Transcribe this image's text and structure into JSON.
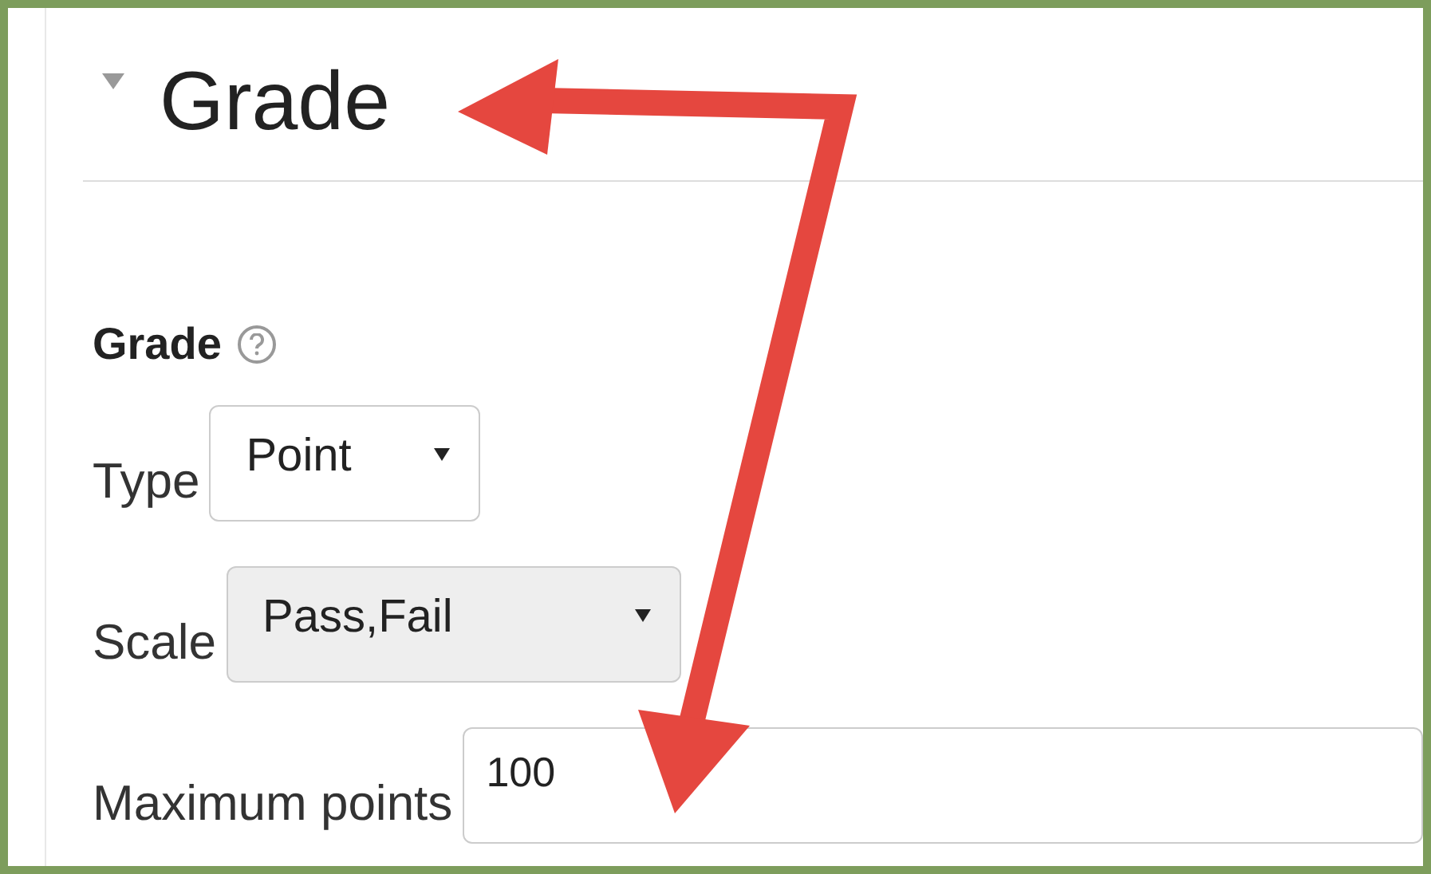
{
  "section": {
    "title": "Grade",
    "expanded": true
  },
  "group": {
    "label": "Grade"
  },
  "fields": [
    {
      "kind": "select",
      "label": "Type",
      "value": "Point",
      "disabled": false
    },
    {
      "kind": "select",
      "label": "Scale",
      "value": "Pass,Fail",
      "disabled": true
    },
    {
      "kind": "text",
      "label": "Maximum points",
      "value": "100",
      "disabled": false
    }
  ]
}
